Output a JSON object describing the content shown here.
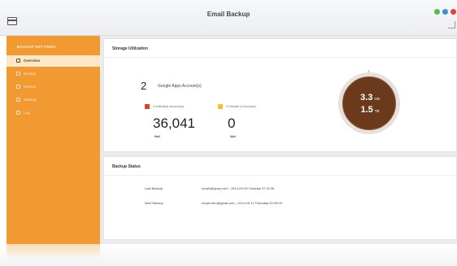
{
  "window": {
    "title": "Email Backup"
  },
  "sidebar": {
    "section_title": "BACKUP SETTINGS",
    "items": [
      {
        "label": "Overview",
        "icon": "overview-icon",
        "active": true
      },
      {
        "label": "Backup",
        "icon": "backup-icon",
        "active": false
      },
      {
        "label": "Restore",
        "icon": "restore-icon",
        "active": false
      },
      {
        "label": "Settings",
        "icon": "settings-icon",
        "active": false
      },
      {
        "label": "Log",
        "icon": "log-icon",
        "active": false
      }
    ]
  },
  "storage": {
    "title": "Storage Utilization",
    "account_count": "2",
    "account_label": "Google Apps Account(s)",
    "legend_individual": "2 Individual account(s)",
    "legend_domain": "0 Domain (0 Account)",
    "mail_count_a": "36,041",
    "mail_label_a": "Mail",
    "mail_count_b": "0",
    "mail_label_b": "Mail",
    "gauge_value_1": "3.3",
    "gauge_unit_1": "GB",
    "gauge_value_2": "1.5",
    "gauge_unit_2": "TB"
  },
  "backup_status": {
    "title": "Backup Status",
    "last_label": "Last Backup",
    "last_value": "tonyfu@qnap.com - 2014-09-09 Tuesday 07:42:36",
    "next_label": "Next Backup",
    "next_value": "tonyfu.tien@gmail.com - 2014-09-11 Thursday 00:00:00"
  },
  "colors": {
    "accent": "#f09a31",
    "legend_red": "#d9432d",
    "legend_yellow": "#f2c22f",
    "gauge_fill": "#6b3a1d"
  }
}
